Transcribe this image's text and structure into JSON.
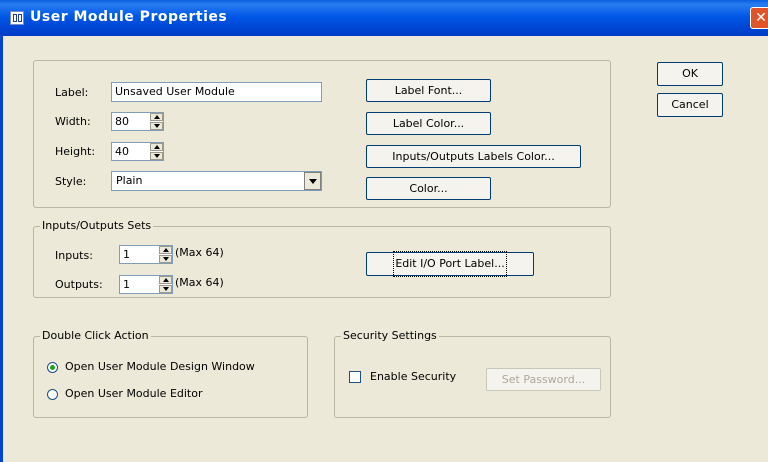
{
  "window": {
    "title": "User Module Properties",
    "close_glyph": "✕"
  },
  "ok_button": "OK",
  "cancel_button": "Cancel",
  "properties": {
    "label_caption": "Label:",
    "label_value": "Unsaved User Module",
    "width_caption": "Width:",
    "width_value": "80",
    "height_caption": "Height:",
    "height_value": "40",
    "style_caption": "Style:",
    "style_value": "Plain",
    "label_font_button": "Label Font...",
    "label_color_button": "Label Color...",
    "io_labels_color_button": "Inputs/Outputs Labels Color...",
    "color_button": "Color..."
  },
  "io_sets": {
    "title": "Inputs/Outputs Sets",
    "inputs_caption": "Inputs:",
    "inputs_value": "1",
    "inputs_max": "(Max 64)",
    "outputs_caption": "Outputs:",
    "outputs_value": "1",
    "outputs_max": "(Max 64)",
    "edit_port_label_button": "Edit I/O Port Label..."
  },
  "double_click": {
    "title": "Double Click Action",
    "options": [
      {
        "label": "Open User Module Design Window",
        "selected": true
      },
      {
        "label": "Open User Module Editor",
        "selected": false
      }
    ]
  },
  "security": {
    "title": "Security Settings",
    "enable_label": "Enable Security",
    "enabled": false,
    "set_password_button": "Set Password..."
  },
  "icons": {
    "title": "app-icon",
    "close": "close-icon",
    "spin": "spin-arrows",
    "dropdown": "chevron-down"
  },
  "colors": {
    "titlebar": "#0058e6",
    "dialog_bg": "#ece9d8",
    "close": "#e0542c"
  }
}
